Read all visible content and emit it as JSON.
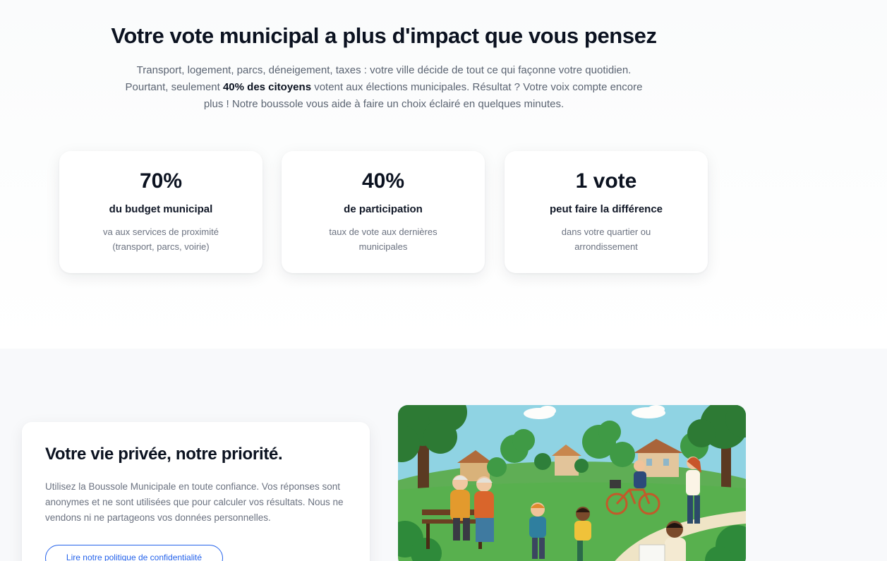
{
  "hero": {
    "title": "Votre vote municipal a plus d'impact que vous pensez",
    "text_before": "Transport, logement, parcs, déneigement, taxes : votre ville décide de tout ce qui façonne votre quotidien. Pourtant, seulement ",
    "text_bold": "40% des citoyens",
    "text_after": " votent aux élections municipales. Résultat ? Votre voix compte encore plus ! Notre boussole vous aide à faire un choix éclairé en quelques minutes."
  },
  "stats": [
    {
      "value": "70%",
      "title": "du budget municipal",
      "desc": "va aux services de proximité (transport, parcs, voirie)"
    },
    {
      "value": "40%",
      "title": "de participation",
      "desc": "taux de vote aux dernières municipales"
    },
    {
      "value": "1 vote",
      "title": "peut faire la différence",
      "desc": "dans votre quartier ou arrondissement"
    }
  ],
  "privacy": {
    "title": "Votre vie privée, notre priorité.",
    "text": "Utilisez la Boussole Municipale en toute confiance. Vos réponses sont anonymes et ne sont utilisées que pour calculer vos résultats. Nous ne vendons ni ne partageons vos données personnelles.",
    "button_label": "Lire notre politique de confidentialité"
  },
  "colors": {
    "accent": "#2563eb",
    "heading": "#0b1220",
    "body_text": "#6b7280"
  }
}
